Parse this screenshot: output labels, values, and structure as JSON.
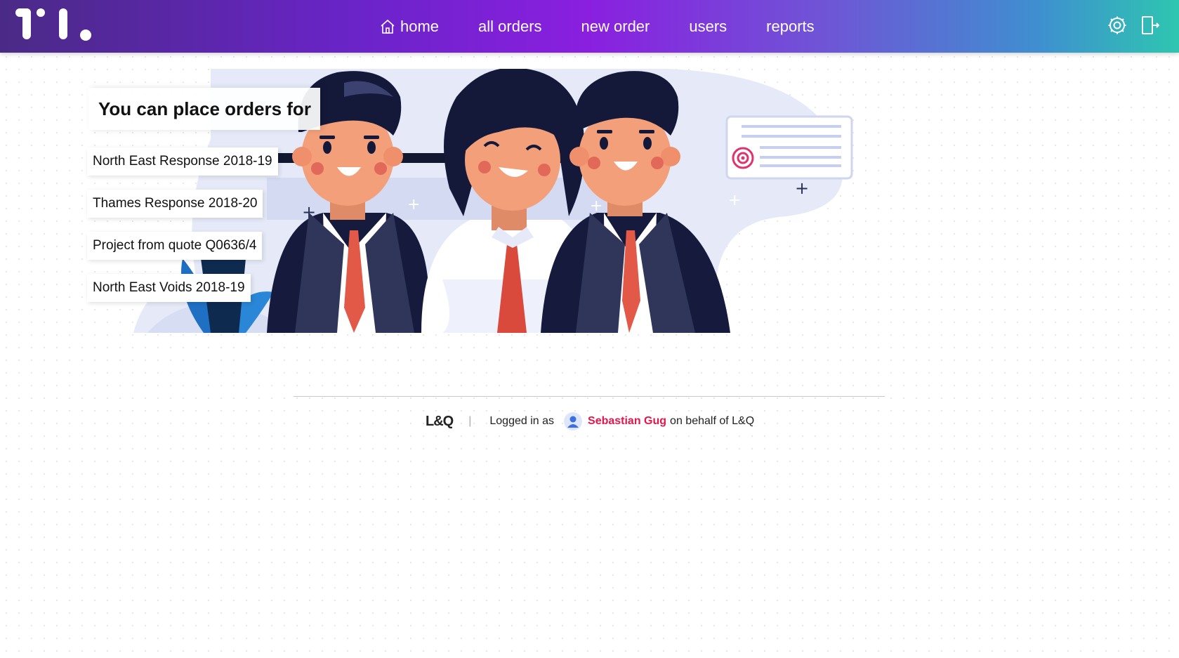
{
  "nav": {
    "items": [
      {
        "label": "home",
        "icon": "home-icon"
      },
      {
        "label": "all orders"
      },
      {
        "label": "new order"
      },
      {
        "label": "users"
      },
      {
        "label": "reports"
      }
    ],
    "settings_icon": "gear-icon",
    "logout_icon": "logout-icon"
  },
  "hero": {
    "heading": "You can place orders for",
    "contracts": [
      "North East Response 2018-19",
      "Thames Response 2018-20",
      "Project from quote Q0636/4",
      "North East Voids 2018-19"
    ]
  },
  "footer": {
    "brand": "L&Q",
    "separator": "|",
    "logged_in_prefix": "Logged in as",
    "user_name": "Sebastian Gug",
    "on_behalf": "on behalf of L&Q"
  },
  "colors": {
    "accent_user": "#e3174b",
    "header_start": "#4a2a86",
    "header_end": "#2ec6b0"
  }
}
